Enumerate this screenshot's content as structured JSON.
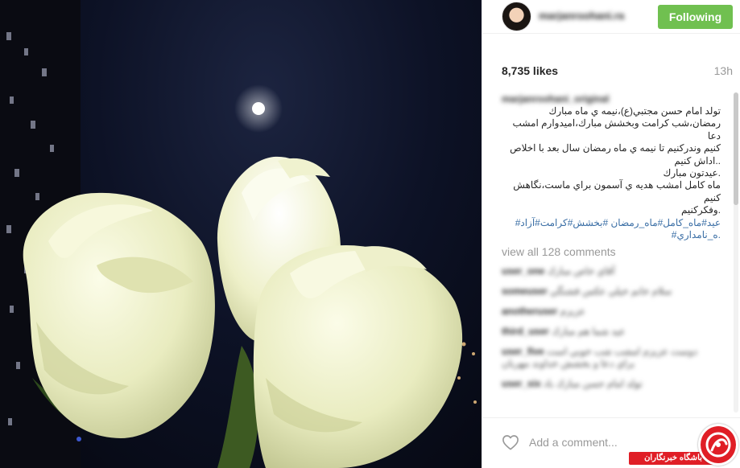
{
  "post": {
    "image_alt": "White roses under the full moon at night",
    "username": "marjanroohani.ra",
    "follow_label": "Following",
    "likes": "8,735 likes",
    "time": "13h",
    "caption_user": "marjanroohani_original",
    "caption_lines": [
      "تولد امام حسن مجتبي(ع)،نيمه ي ماه مبارك",
      "رمضان،شب كرامت وبخشش مبارك،اميدوارم امشب دعا",
      "كنيم وندركنيم تا نيمه ي ماه رمضان سال بعد با اخلاص",
      "..اداش كنيم",
      ".عيدتون مبارك",
      "ماه كامل امشب هديه ي آسمون براي ماست،نگاهش كنيم",
      ".وفكركنيم"
    ],
    "hashtag_lines": [
      "عيد#ماه_كامل#ماه_رمضان  #بخشش#كرامت#آزاد#",
      ".ه_نامداري#"
    ],
    "view_all": "view all 128 comments",
    "comments": [
      {
        "user": "user_one",
        "text": "آقاي خاص مبارك"
      },
      {
        "user": "someuser",
        "text": "سلام خانم خيلي عكس قشنگي"
      },
      {
        "user": "anotheruser",
        "text": "عزيزم"
      },
      {
        "user": "third_user",
        "text": "عيد شما هم مبارك"
      },
      {
        "user": "user_five",
        "text": "دوست عزيزم امشب شب خوبي است براي دعا و بخشش خداوند مهربان"
      },
      {
        "user": "user_six",
        "text": "تولد امام حسن مبارك باد"
      }
    ],
    "comment_placeholder": "Add a comment..."
  },
  "watermark": {
    "text": "باشگاه خبرنگاران"
  },
  "colors": {
    "follow_button": "#70c050",
    "hashtag": "#3a6ea5",
    "watermark_red": "#e01e26"
  },
  "icons": {
    "like": "heart-outline-icon"
  }
}
